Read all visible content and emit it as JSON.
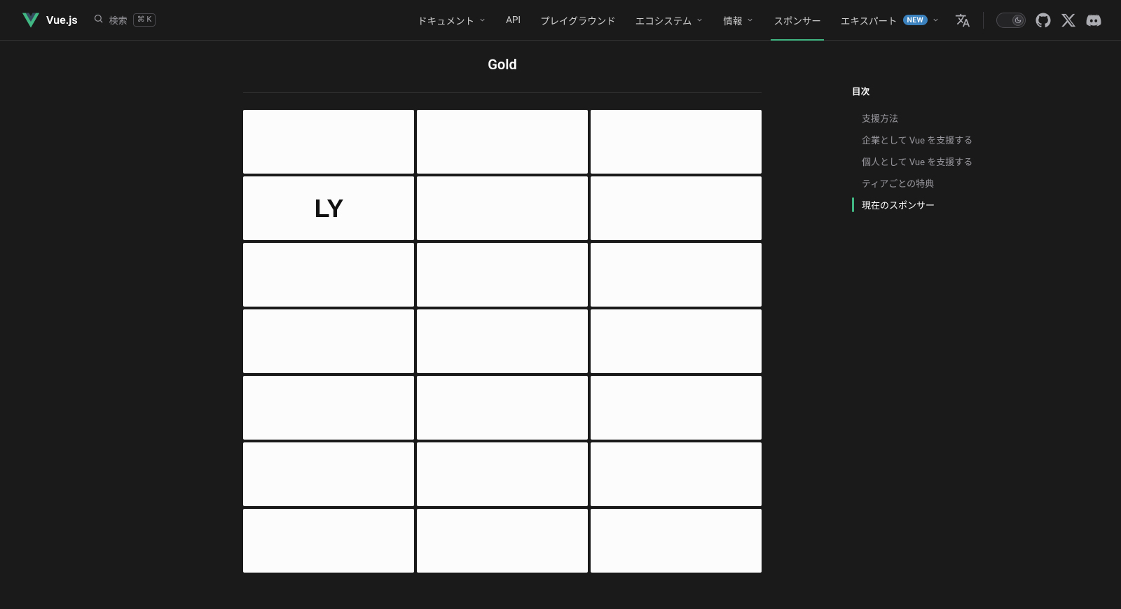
{
  "brand": {
    "name": "Vue.js"
  },
  "search": {
    "label": "検索",
    "shortcut": "⌘ K"
  },
  "nav": {
    "items": [
      {
        "label": "ドキュメント",
        "dropdown": true,
        "active": false
      },
      {
        "label": "API",
        "dropdown": false,
        "active": false
      },
      {
        "label": "プレイグラウンド",
        "dropdown": false,
        "active": false
      },
      {
        "label": "エコシステム",
        "dropdown": true,
        "active": false
      },
      {
        "label": "情報",
        "dropdown": true,
        "active": false
      },
      {
        "label": "スポンサー",
        "dropdown": false,
        "active": true
      },
      {
        "label": "エキスパート",
        "dropdown": true,
        "active": false,
        "badge": "NEW"
      }
    ]
  },
  "main": {
    "section_title": "Gold",
    "sponsors": [
      {
        "logo": ""
      },
      {
        "logo": ""
      },
      {
        "logo": ""
      },
      {
        "logo": "LY"
      },
      {
        "logo": ""
      },
      {
        "logo": ""
      },
      {
        "logo": ""
      },
      {
        "logo": ""
      },
      {
        "logo": ""
      },
      {
        "logo": ""
      },
      {
        "logo": ""
      },
      {
        "logo": ""
      },
      {
        "logo": ""
      },
      {
        "logo": ""
      },
      {
        "logo": ""
      },
      {
        "logo": ""
      },
      {
        "logo": ""
      },
      {
        "logo": ""
      },
      {
        "logo": ""
      },
      {
        "logo": ""
      },
      {
        "logo": ""
      }
    ]
  },
  "aside": {
    "title": "目次",
    "items": [
      {
        "label": "支援方法",
        "active": false
      },
      {
        "label": "企業として Vue を支援する",
        "active": false
      },
      {
        "label": "個人として Vue を支援する",
        "active": false
      },
      {
        "label": "ティアごとの特典",
        "active": false
      },
      {
        "label": "現在のスポンサー",
        "active": true
      }
    ]
  }
}
